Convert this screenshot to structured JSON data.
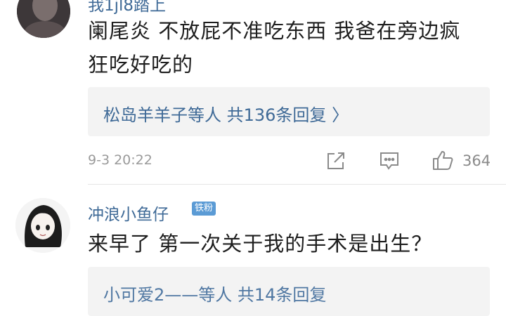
{
  "comments": [
    {
      "username": "我1jl8踏上",
      "text_line1": "阑尾炎 不放屁不准吃东西 我爸在旁边疯",
      "text_line2": "狂吃好吃的",
      "reply_summary": "松岛羊羊子等人 共136条回复 〉",
      "time": "9-3 20:22",
      "likes": "364",
      "icons": [
        "share-icon",
        "comment-icon",
        "thumbs-up-icon"
      ]
    },
    {
      "username": "冲浪小鱼仔",
      "badge": "铁粉",
      "text_line1": "来早了 第一次关于我的手术是出生？",
      "reply_summary": "小可爱2——等人 共14条回复"
    }
  ],
  "colors": {
    "username": "#3f6a97",
    "reply_bg": "#f3f3f3",
    "meta": "#9a9a9a",
    "badge": "#5b9bd5"
  }
}
